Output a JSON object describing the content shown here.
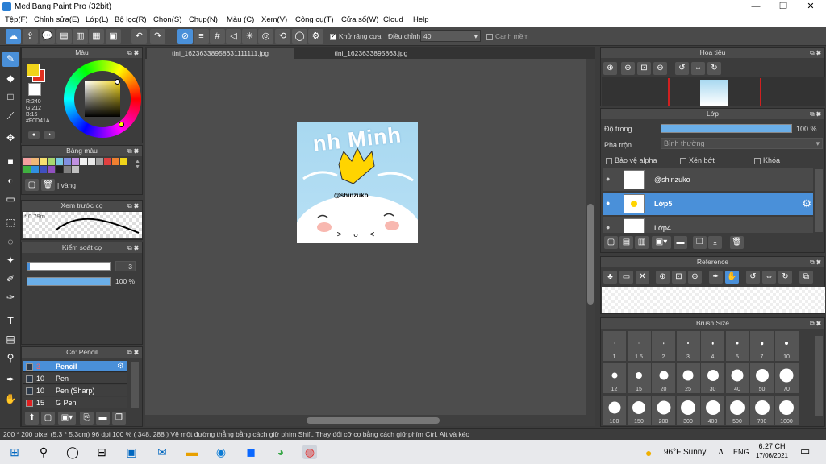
{
  "window": {
    "title": "MediBang Paint Pro (32bit)"
  },
  "menu": [
    "Tệp(F)",
    "Chỉnh sửa(E)",
    "Lớp(L)",
    "Bộ lọc(R)",
    "Chọn(S)",
    "Chụp(N)",
    "Màu (C)",
    "Xem(V)",
    "Công cụ(T)",
    "Cửa sổ(W)",
    "Cloud",
    "Help"
  ],
  "toolbar": {
    "antialias_label": "Khử răng cưa",
    "antialias_checked": true,
    "adjust_label": "Điều chỉnh",
    "adjust_value": "40",
    "snap_label": "Canh mềm"
  },
  "tabs": [
    "tini_16236338958631111111.jpg",
    "tini_1623633895863.jpg"
  ],
  "color_panel": {
    "title": "Màu",
    "r": "R:240",
    "g": "G:212",
    "b": "B:16",
    "hex": "#F0D41A",
    "primary": "#F0D41A",
    "secondary": "#E03020"
  },
  "palette_panel": {
    "title": "Bảng màu",
    "current": "vàng"
  },
  "brush_preview_panel": {
    "title": "Xem trước cọ",
    "size": "0.79m"
  },
  "brush_control_panel": {
    "title": "Kiểm soát cọ",
    "size_value": "3",
    "opacity_value": "100 %"
  },
  "brush_panel": {
    "title": "Cọ: Pencil",
    "items": [
      {
        "size": "3",
        "name": "Pencil",
        "selected": true,
        "color": "#2d3a4a"
      },
      {
        "size": "10",
        "name": "Pen",
        "selected": false,
        "color": "#2d3a4a"
      },
      {
        "size": "10",
        "name": "Pen (Sharp)",
        "selected": false,
        "color": "#2d3a4a"
      },
      {
        "size": "15",
        "name": "G Pen",
        "selected": false,
        "color": "#e02020"
      }
    ]
  },
  "artwork": {
    "text_top": "nh Minh",
    "tag": "@shinzuko",
    "face": "> ᴗ <"
  },
  "navigator_panel": {
    "title": "Hoa tiêu"
  },
  "layer_panel": {
    "title": "Lớp",
    "opacity_label": "Độ trong",
    "opacity_value": "100 %",
    "blend_label": "Pha trộn",
    "blend_value": "Bình thường",
    "protect_alpha": "Bảo vệ alpha",
    "clipping": "Xén bớt",
    "lock": "Khóa",
    "layers": [
      {
        "name": "@shinzuko",
        "selected": false
      },
      {
        "name": "Lớp5",
        "selected": true
      },
      {
        "name": "Lớp4",
        "selected": false
      }
    ]
  },
  "reference_panel": {
    "title": "Reference"
  },
  "brush_size_panel": {
    "title": "Brush Size",
    "sizes": [
      "1",
      "1.5",
      "2",
      "3",
      "4",
      "5",
      "7",
      "10",
      "12",
      "15",
      "20",
      "25",
      "30",
      "40",
      "50",
      "70",
      "100",
      "150",
      "200",
      "300",
      "400",
      "500",
      "700",
      "1000"
    ]
  },
  "status": {
    "text": "200 * 200 pixel   (5.3 * 5.3cm)   96 dpi   100 %   ( 348, 288 )   Vẽ một đường thẳng bằng cách giữ phím Shift, Thay đổi cỡ cọ bằng cách giữ phím Ctrl, Alt và kéo"
  },
  "taskbar": {
    "weather": "96°F  Sunny",
    "lang": "ENG",
    "time": "6:27 CH",
    "date": "17/06/2021"
  },
  "colors": {
    "accent": "#4a90d9",
    "panel_bg": "#3c3c3c"
  }
}
